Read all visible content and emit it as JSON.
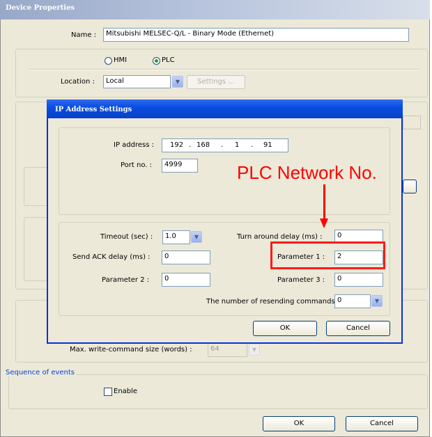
{
  "outer": {
    "title": "Device Properties",
    "name_label": "Name :",
    "name_value": "Mitsubishi MELSEC-Q/L - Binary Mode (Ethernet)",
    "radio_hmi": "HMI",
    "radio_plc": "PLC",
    "location_label": "Location :",
    "location_value": "Local",
    "settings_button": "Settings ...",
    "max_write_label": "Max. write-command size (words) :",
    "max_write_value": "64",
    "sequence_group": "Sequence of events",
    "enable_label": "Enable",
    "ok": "OK",
    "cancel": "Cancel"
  },
  "inner": {
    "title": "IP Address Settings",
    "ip_label": "IP address :",
    "ip": [
      "192",
      "168",
      "1",
      "91"
    ],
    "port_label": "Port no. :",
    "port_value": "4999",
    "timeout_label": "Timeout (sec) :",
    "timeout_value": "1.0",
    "turnaround_label": "Turn around delay (ms) :",
    "turnaround_value": "0",
    "send_ack_label": "Send ACK delay (ms) :",
    "send_ack_value": "0",
    "param1_label": "Parameter 1 :",
    "param1_value": "2",
    "param2_label": "Parameter 2 :",
    "param2_value": "0",
    "param3_label": "Parameter 3 :",
    "param3_value": "0",
    "resend_label": "The number of resending commands :",
    "resend_value": "0",
    "ok": "OK",
    "cancel": "Cancel"
  },
  "annotation": {
    "text": "PLC Network No.",
    "color": "#ff0000"
  },
  "colors": {
    "dialog_bg": "#ece9d8",
    "inner_title": "#0a4de0",
    "outer_title": "#98a8c8"
  },
  "icons": {
    "combo": "chevron-down-icon",
    "radio": "radio-icon"
  }
}
